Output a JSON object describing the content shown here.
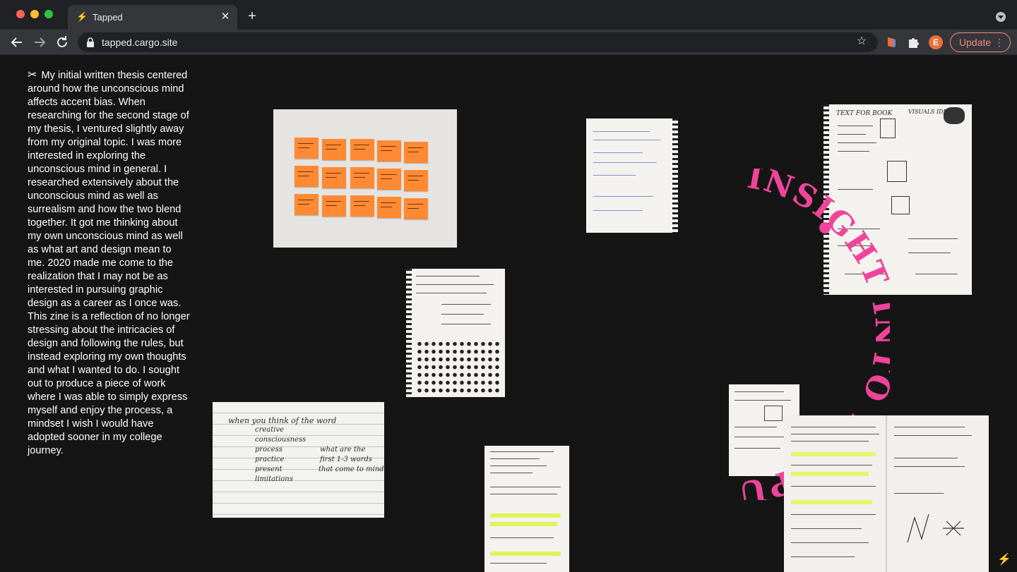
{
  "browser": {
    "tab_title": "Tapped",
    "new_tab_symbol": "+",
    "close_symbol": "✕",
    "url": "tapped.cargo.site",
    "avatar_initial": "E",
    "update_label": "Update",
    "menu_symbol": "⋮"
  },
  "page": {
    "thesis_icon": "✂",
    "thesis_text": "My initial written thesis centered around how the unconscious mind affects accent bias. When researching for the second stage of my thesis, I ventured slightly away from my original topic. I was more interested in exploring the unconscious mind in general. I researched extensively about the unconscious mind as well as surrealism and how the two blend together. It got me thinking about my own unconscious mind as well as what art and design mean to me. 2020 made me come to the realization that I may not be as interested in pursuing graphic design as a career as I once was. This zine is a reflection of no longer stressing about the intricacies of design and following the rules, but instead exploring my own thoughts and what I wanted to do. I sought out to produce a piece of work where I was able to simply express myself and enjoy the process, a mindset I wish I would have adopted sooner in my college journey.",
    "circular_text": "INSIGHT INTO THE PUZZLE OF HIS INDIVIDUALITY",
    "notebook_heading": "when you think of the word",
    "notebook_words": [
      "creative",
      "consciousness",
      "process",
      "practice",
      "present",
      "limitations"
    ],
    "notebook_aside": [
      "what are the",
      "first 1-3 words",
      "that come to mind"
    ],
    "sketch_heading": "TEXT FOR BOOK",
    "sketch_side_heading": "VISUALS IDEA",
    "accent_color": "#f0449a"
  }
}
